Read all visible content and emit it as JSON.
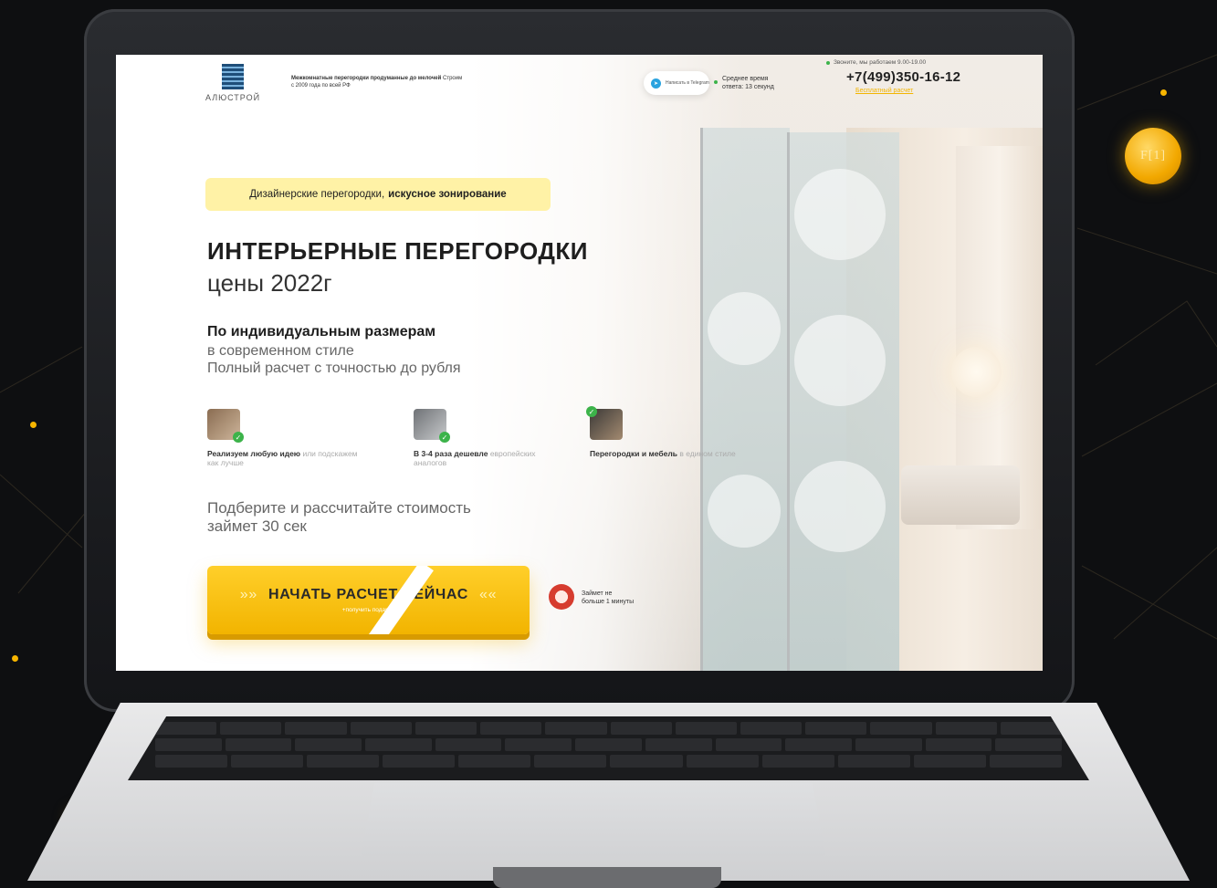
{
  "header": {
    "logo_text": "АЛЮСТРОЙ",
    "tagline_bold": "Межкомнатные перегородки продуманные до мелочей",
    "tagline_rest": "Строим с 2009 года по всей РФ",
    "telegram_label": "Написать в Telegram",
    "response_label": "Среднее время",
    "response_value": "ответа: 13 секунд",
    "hours": "Звоните, мы работаем 9.00-19.00",
    "phone": "+7(499)350-16-12",
    "callback_label": "Бесплатный расчет"
  },
  "hero": {
    "badge_text": "Дизайнерские перегородки,",
    "badge_bold": "искусное зонирование",
    "title": "ИНТЕРЬЕРНЫЕ ПЕРЕГОРОДКИ",
    "subtitle": "цены 2022г",
    "lead": "По индивидуальным размерам",
    "lead_line2": "в современном стиле",
    "lead_line3": "Полный расчет с точностью до рубля",
    "features": [
      {
        "bold": "Реализуем любую идею",
        "rest": "или подскажем как лучше"
      },
      {
        "bold": "В 3-4 раза дешевле",
        "rest": "европейских аналогов"
      },
      {
        "bold": "Перегородки и мебель",
        "rest": "в едином стиле"
      }
    ],
    "calc_line1": "Подберите и рассчитайте стоимость",
    "calc_line2": "займет 30 сек",
    "cta_label": "НАЧАТЬ РАСЧЕТ СЕЙЧАС",
    "cta_chevrons_left": "»»",
    "cta_chevrons_right": "««",
    "cta_sub": "+получить подарок",
    "timer_line1": "Займет не",
    "timer_line2": "больше 1 минуты"
  },
  "decor": {
    "coin_label": "F[1]",
    "accent": "#f7b500"
  }
}
